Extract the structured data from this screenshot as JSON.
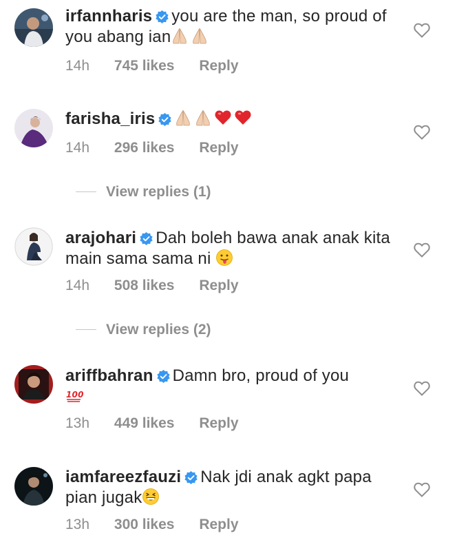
{
  "comments": [
    {
      "username": "irfannharis",
      "text": "you are the man, so proud of you abang ian",
      "emojis": [
        "folded-hands-emoji",
        "folded-hands-emoji"
      ],
      "time": "14h",
      "likes": "745 likes",
      "reply": "Reply"
    },
    {
      "username": "farisha_iris",
      "text": "",
      "emojis": [
        "folded-hands-emoji",
        "folded-hands-emoji",
        "red-heart-emoji",
        "red-heart-emoji"
      ],
      "time": "14h",
      "likes": "296 likes",
      "reply": "Reply",
      "view_replies": "View replies (1)"
    },
    {
      "username": "arajohari",
      "text": "Dah boleh bawa anak anak kita main sama sama ni",
      "emojis": [
        "tongue-out-face-emoji"
      ],
      "time": "14h",
      "likes": "508 likes",
      "reply": "Reply",
      "view_replies": "View replies (2)"
    },
    {
      "username": "ariffbahran",
      "text": "Damn bro, proud of you",
      "emojis": [
        "hundred-points-emoji"
      ],
      "time": "13h",
      "likes": "449 likes",
      "reply": "Reply"
    },
    {
      "username": "iamfareezfauzi",
      "text": "Nak jdi anak agkt papa pian jugak",
      "emojis": [
        "grinning-squinting-face-emoji"
      ],
      "time": "13h",
      "likes": "300 likes",
      "reply": "Reply"
    }
  ],
  "colors": {
    "text": "#262626",
    "meta": "#8e8e8e",
    "verified": "#3897f0",
    "heart_outline": "#8e8e8e"
  }
}
